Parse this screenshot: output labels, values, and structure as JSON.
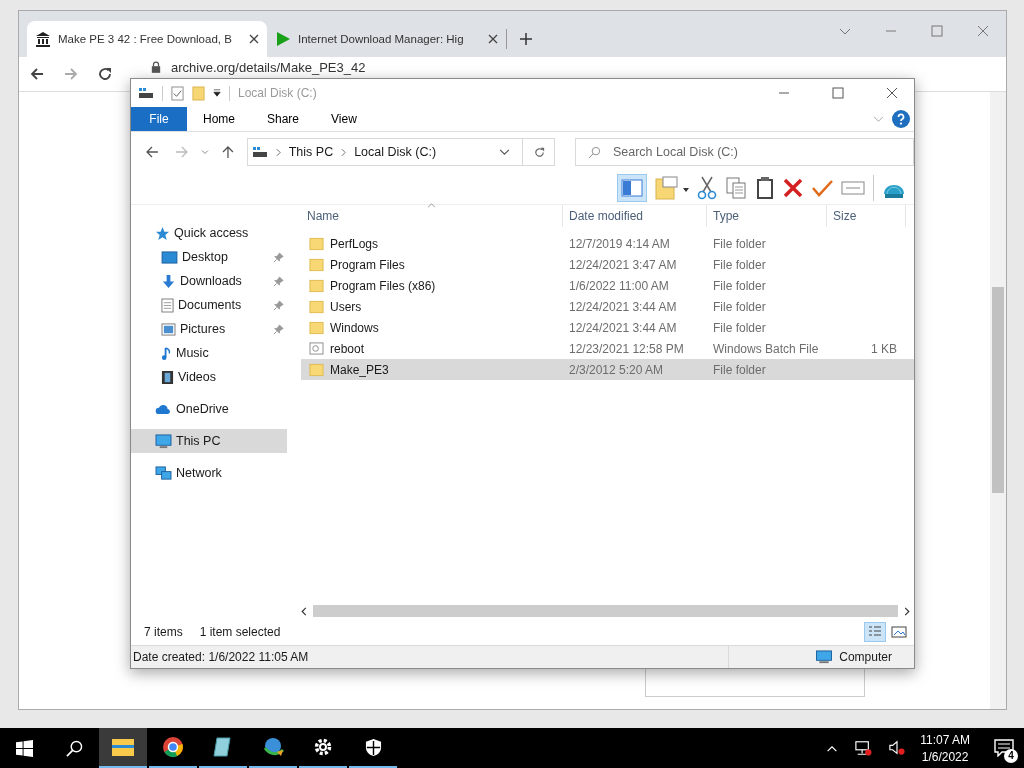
{
  "browser": {
    "tabs": [
      {
        "title": "Make PE 3 42 : Free Download, B",
        "selected": true
      },
      {
        "title": "Internet Download Manager: Hig",
        "selected": false
      }
    ],
    "address": "archive.org/details/Make_PE3_42"
  },
  "explorer": {
    "title": "Local Disk (C:)",
    "ribbon_tabs": [
      {
        "label": "File",
        "kind": "file"
      },
      {
        "label": "Home",
        "kind": "tab"
      },
      {
        "label": "Share",
        "kind": "tab"
      },
      {
        "label": "View",
        "kind": "tab"
      }
    ],
    "breadcrumb": [
      "This PC",
      "Local Disk (C:)"
    ],
    "search": {
      "placeholder": "Search Local Disk (C:)"
    },
    "sidebar": [
      {
        "label": "Quick access",
        "selected": false,
        "children": [
          {
            "label": "Desktop",
            "pinned": true
          },
          {
            "label": "Downloads",
            "pinned": true
          },
          {
            "label": "Documents",
            "pinned": true
          },
          {
            "label": "Pictures",
            "pinned": true
          },
          {
            "label": "Music",
            "pinned": false
          },
          {
            "label": "Videos",
            "pinned": false
          }
        ]
      },
      {
        "label": "OneDrive",
        "selected": false
      },
      {
        "label": "This PC",
        "selected": true
      },
      {
        "label": "Network",
        "selected": false
      }
    ],
    "columns": [
      "Name",
      "Date modified",
      "Type",
      "Size"
    ],
    "rows": [
      {
        "name": "PerfLogs",
        "date": "12/7/2019 4:14 AM",
        "type": "File folder",
        "kind": "folder",
        "selected": false
      },
      {
        "name": "Program Files",
        "date": "12/24/2021 3:47 AM",
        "type": "File folder",
        "kind": "folder",
        "selected": false
      },
      {
        "name": "Program Files (x86)",
        "date": "1/6/2022 11:00 AM",
        "type": "File folder",
        "kind": "folder",
        "selected": false
      },
      {
        "name": "Users",
        "date": "12/24/2021 3:44 AM",
        "type": "File folder",
        "kind": "folder",
        "selected": false
      },
      {
        "name": "Windows",
        "date": "12/24/2021 3:44 AM",
        "type": "File folder",
        "kind": "folder",
        "selected": false
      },
      {
        "name": "reboot",
        "date": "12/23/2021 12:58 PM",
        "type": "Windows Batch File",
        "size": "1 KB",
        "kind": "file",
        "selected": false
      },
      {
        "name": "Make_PE3",
        "date": "2/3/2012 5:20 AM",
        "type": "File folder",
        "kind": "folder",
        "selected": true
      }
    ],
    "status": {
      "count": "7 items",
      "selection": "1 item selected"
    },
    "details": {
      "text": "Date created: 1/6/2022 11:05 AM",
      "zone": "Computer"
    }
  },
  "taskbar": {
    "apps": [
      {
        "selected": true
      },
      {
        "selected": false
      },
      {
        "selected": false
      },
      {
        "selected": false
      },
      {
        "selected": false
      },
      {
        "selected": false
      }
    ],
    "time": "11:07 AM",
    "date": "1/6/2022",
    "notifications": "4"
  }
}
